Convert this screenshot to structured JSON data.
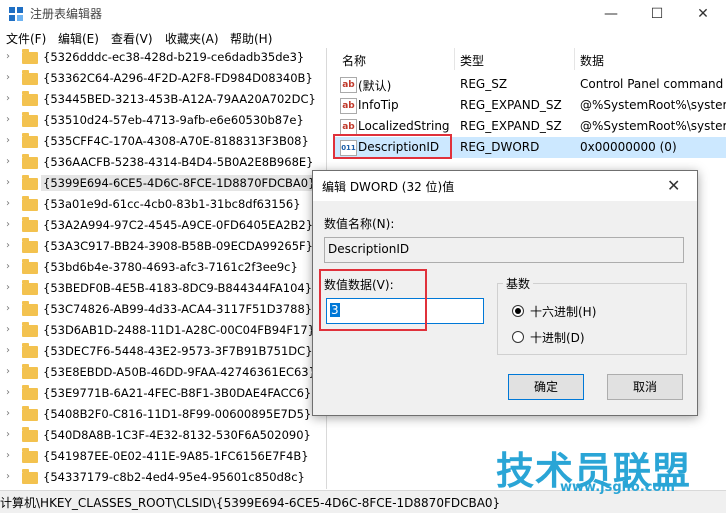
{
  "window": {
    "title": "注册表编辑器",
    "min_glyph": "—",
    "max_glyph": "☐",
    "close_glyph": "✕"
  },
  "menu": [
    "文件(F)",
    "编辑(E)",
    "查看(V)",
    "收藏夹(A)",
    "帮助(H)"
  ],
  "tree": {
    "selected_index": 7,
    "items": [
      "{5326dddc-ec38-428d-b219-ce6dadb35de3}",
      "{53362C64-A296-4F2D-A2F8-FD984D08340B}",
      "{53445BED-3213-453B-A12A-79AA20A702DC}",
      "{53510d24-57eb-4713-9afb-e6e60530b87e}",
      "{535CFF4C-170A-4308-A70E-8188313F3B08}",
      "{536AACFB-5238-4314-B4D4-5B0A2E8B968E}",
      "{5399E694-6CE5-4D6C-8FCE-1D8870FDCBA0}",
      "{53a01e9d-61cc-4cb0-83b1-31bc8df63156}",
      "{53A2A994-97C2-4545-A9CE-0FD6405EA2B2}",
      "{53A3C917-BB24-3908-B58B-09ECDA99265F}",
      "{53bd6b4e-3780-4693-afc3-7161c2f3ee9c}",
      "{53BEDF0B-4E5B-4183-8DC9-B844344FA104}",
      "{53C74826-AB99-4d33-ACA4-3117F51D3788}",
      "{53D6AB1D-2488-11D1-A28C-00C04FB94F17}",
      "{53DEC7F6-5448-43E2-9573-3F7B91B751DC}",
      "{53E8EBDD-A50B-46DD-9FAA-42746361EC63}",
      "{53E9771B-6A21-4FEC-B8F1-3B0DAE4FACC6}",
      "{5408B2F0-C816-11D1-8F99-00600895E7D5}",
      "{540D8A8B-1C3F-4E32-8132-530F6A502090}",
      "{541987EE-0E02-411E-9A85-1FC6156E7F4B}",
      "{54337179-c8b2-4ed4-95e4-95601c850d8c}"
    ]
  },
  "list": {
    "headers": {
      "name": "名称",
      "type": "类型",
      "data": "数据"
    },
    "rows": [
      {
        "icon": "ab",
        "name": "(默认)",
        "type": "REG_SZ",
        "data": "Control Panel command"
      },
      {
        "icon": "ab",
        "name": "InfoTip",
        "type": "REG_EXPAND_SZ",
        "data": "@%SystemRoot%\\syster"
      },
      {
        "icon": "ab",
        "name": "LocalizedString",
        "type": "REG_EXPAND_SZ",
        "data": "@%SystemRoot%\\syster"
      },
      {
        "icon": "011",
        "name": "DescriptionID",
        "type": "REG_DWORD",
        "data": "0x00000000 (0)"
      }
    ]
  },
  "status": "计算机\\HKEY_CLASSES_ROOT\\CLSID\\{5399E694-6CE5-4D6C-8FCE-1D8870FDCBA0}",
  "dialog": {
    "title": "编辑 DWORD (32 位)值",
    "close_glyph": "✕",
    "name_label": "数值名称(N):",
    "name_value": "DescriptionID",
    "data_label": "数值数据(V):",
    "data_value": "3",
    "base_label": "基数",
    "radio_hex": "十六进制(H)",
    "radio_dec": "十进制(D)",
    "selected_base": "hex",
    "ok": "确定",
    "cancel": "取消"
  },
  "watermark": {
    "big": "技术员联盟",
    "url": "www.jsgho.com"
  },
  "colors": {
    "highlight_red": "#e0313b",
    "accent": "#0078d7",
    "folder": "#f3c24f",
    "watermark": "#2aa5d6"
  }
}
